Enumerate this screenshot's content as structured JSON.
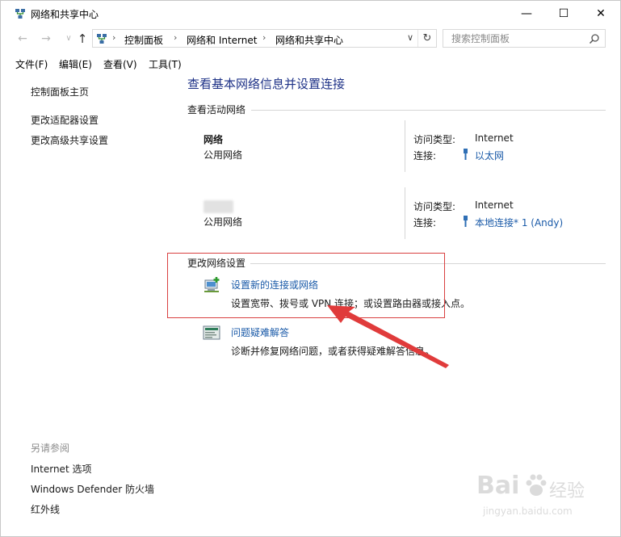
{
  "window": {
    "title": "网络和共享中心",
    "controls": {
      "minimize": "—",
      "maximize": "☐",
      "close": "✕"
    }
  },
  "address_bar": {
    "crumbs": [
      "控制面板",
      "网络和 Internet",
      "网络和共享中心"
    ],
    "separator": "›",
    "dropdown": "∨",
    "refresh": "↻"
  },
  "nav": {
    "back": "←",
    "forward": "→",
    "up": "↑"
  },
  "search": {
    "placeholder": "搜索控制面板"
  },
  "menu": {
    "items": [
      "文件(F)",
      "编辑(E)",
      "查看(V)",
      "工具(T)"
    ]
  },
  "sidebar": {
    "links": [
      "控制面板主页",
      "更改适配器设置",
      "更改高级共享设置"
    ],
    "see_also_heading": "另请参阅",
    "see_also": [
      "Internet 选项",
      "Windows Defender 防火墙",
      "红外线"
    ]
  },
  "main": {
    "title": "查看基本网络信息并设置连接",
    "active_heading": "查看活动网络",
    "networks": [
      {
        "name": "网络",
        "type": "公用网络",
        "access_label": "访问类型:",
        "access_value": "Internet",
        "conn_label": "连接:",
        "conn_value": "以太网"
      },
      {
        "name": "",
        "type": "公用网络",
        "access_label": "访问类型:",
        "access_value": "Internet",
        "conn_label": "连接:",
        "conn_value": "本地连接* 1 (Andy)"
      }
    ],
    "change_heading": "更改网络设置",
    "tasks": [
      {
        "link": "设置新的连接或网络",
        "desc": "设置宽带、拨号或 VPN 连接；或设置路由器或接入点。",
        "icon": "new-connection-icon"
      },
      {
        "link": "问题疑难解答",
        "desc": "诊断并修复网络问题，或者获得疑难解答信息。",
        "icon": "troubleshoot-icon"
      }
    ]
  },
  "watermark": {
    "brand": "Bai",
    "brand_cn": "经验",
    "url": "jingyan.baidu.com"
  },
  "colors": {
    "title_blue": "#1e3287",
    "link_blue": "#1a5aa8",
    "annotation_red": "#d94040"
  }
}
